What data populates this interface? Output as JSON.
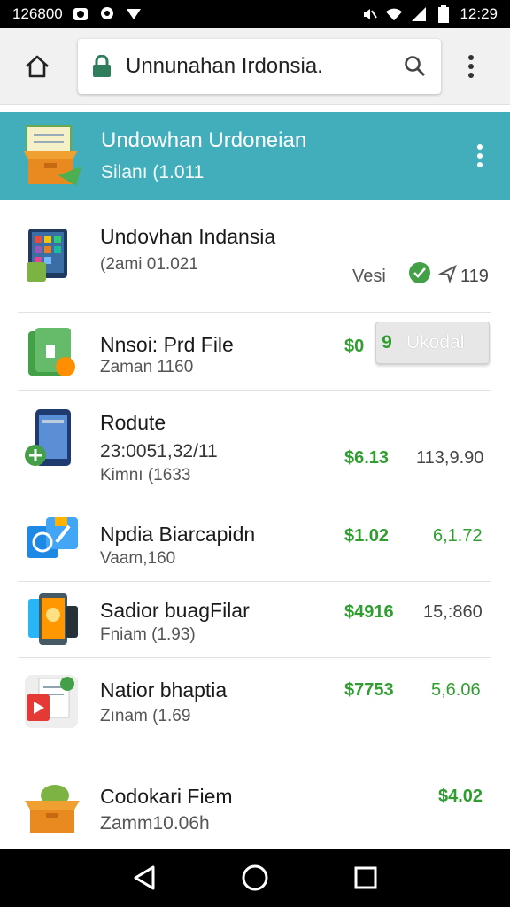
{
  "status_bar": {
    "left_text": "126800",
    "time": "12:29"
  },
  "browser": {
    "url": "Unnunahan Irdonsia.",
    "icons": [
      "home-icon",
      "lock-icon",
      "search-icon",
      "overflow-menu-icon"
    ]
  },
  "header": {
    "title": "Undowhan Urdoneian",
    "subtitle": "Silanı (1.011"
  },
  "items": [
    {
      "name": "Undovhan Indansia",
      "sub": "(2ami 01.021",
      "extra_label": "Vesi",
      "extra_count": "119"
    },
    {
      "name": "Nnsoi: Prd File",
      "sub": "Zaman 1160",
      "price": "$0",
      "button_num": "9",
      "button_label": "Ukodal"
    },
    {
      "name": "Rodute",
      "sub": "23:0051,32/11",
      "sub2": "Kimnı (1633",
      "price": "$6.13",
      "count": "113,9.90"
    },
    {
      "name": "Npdia Biarcapidn",
      "sub": "Vaam,160",
      "price": "$1.02",
      "count": "6,1.72"
    },
    {
      "name": "Sadior buagFilar",
      "sub": "Fniam (1.93)",
      "price": "$4916",
      "count": "15,:860"
    },
    {
      "name": "Natior bhaptia",
      "sub": "Zınam (1.69",
      "price": "$7753",
      "count": "5,6.06"
    },
    {
      "name": "Codokari Fiem",
      "sub": "Zamm10.06h",
      "price": "$4.02"
    }
  ],
  "nav": [
    "back-icon",
    "home-icon",
    "recents-icon"
  ],
  "colors": {
    "header": "#43aebb",
    "price": "#2f9e2f"
  }
}
